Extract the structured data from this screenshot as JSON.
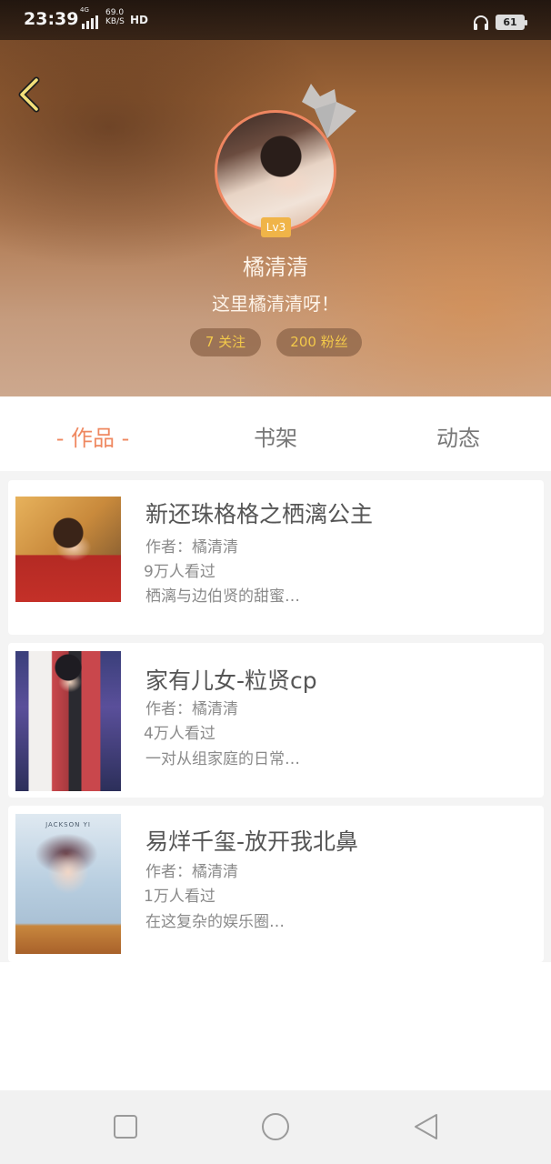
{
  "status_bar": {
    "time": "23:39",
    "network": "4G",
    "speed_value": "69.0",
    "speed_unit": "KB/S",
    "hd": "HD",
    "battery": "61"
  },
  "profile": {
    "level": "Lv3",
    "username": "橘清清",
    "bio": "这里橘清清呀！",
    "following": "7 关注",
    "fans": "200 粉丝"
  },
  "tabs": [
    {
      "label": "-  作品  -",
      "active": true
    },
    {
      "label": "书架",
      "active": false
    },
    {
      "label": "动态",
      "active": false
    }
  ],
  "works": [
    {
      "title": "新还珠格格之栖漓公主",
      "author": "作者：橘清清",
      "views": "9万人看过",
      "desc": "栖漓与边伯贤的甜蜜…"
    },
    {
      "title": "家有儿女-粒贤cp",
      "author": "作者：橘清清",
      "views": "4万人看过",
      "desc": "一对从组家庭的日常…"
    },
    {
      "title": "易烊千玺-放开我北鼻",
      "author": "作者：橘清清",
      "views": "1万人看过",
      "desc": "在这复杂的娱乐圈…",
      "cover_text": "JACKSON YI"
    }
  ],
  "colors": {
    "accent": "#ef8860",
    "badge": "#f0b448",
    "pill_text": "#f3c94a"
  }
}
